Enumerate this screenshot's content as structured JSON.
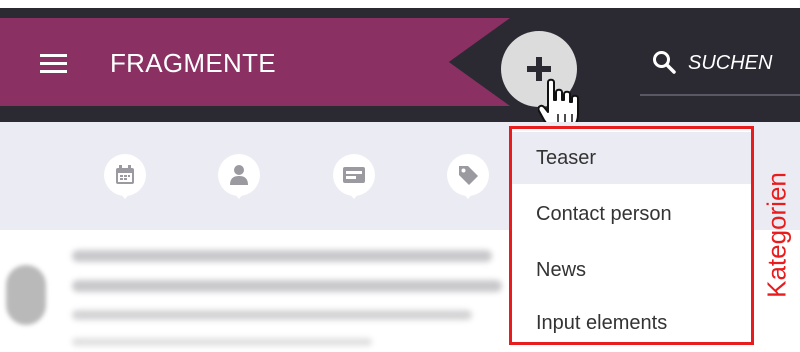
{
  "header": {
    "title": "FRAGMENTE",
    "search_placeholder": "SUCHEN"
  },
  "filters": [
    {
      "icon": "calendar-icon"
    },
    {
      "icon": "person-icon"
    },
    {
      "icon": "card-icon"
    },
    {
      "icon": "tag-icon"
    }
  ],
  "dropdown": {
    "items": [
      {
        "label": "Teaser",
        "active": true
      },
      {
        "label": "Contact person",
        "active": false
      },
      {
        "label": "News",
        "active": false
      },
      {
        "label": "Input elements",
        "active": false
      }
    ]
  },
  "annotation": {
    "label": "Kategorien",
    "color": "#e81c1c"
  },
  "colors": {
    "accent": "#8a3063",
    "topbar": "#2b2a33",
    "filterbar": "#ebebf3"
  }
}
